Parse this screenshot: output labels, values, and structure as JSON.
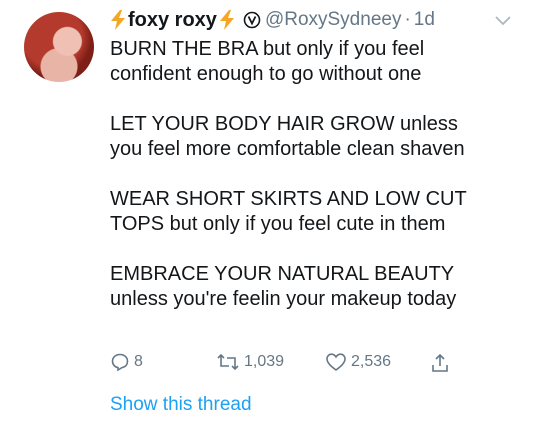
{
  "tweet": {
    "display_name": "foxy roxy",
    "handle": "@RoxySydneey",
    "separator": "·",
    "timestamp": "1d",
    "paragraphs": [
      {
        "line1": "BURN THE BRA but only if you feel",
        "line2": "confident enough to go without one"
      },
      {
        "line1": "LET YOUR BODY HAIR GROW unless",
        "line2": "you feel more comfortable clean shaven"
      },
      {
        "line1": "WEAR SHORT SKIRTS AND LOW CUT",
        "line2": "TOPS but only if you feel cute in them"
      },
      {
        "line1": "EMBRACE YOUR NATURAL BEAUTY",
        "line2": "unless you're feelin your makeup today"
      }
    ],
    "actions": {
      "reply_count": "8",
      "retweet_count": "1,039",
      "like_count": "2,536"
    },
    "show_thread": "Show this thread"
  },
  "colors": {
    "text": "#14171a",
    "secondary": "#657786",
    "link": "#1da1f2",
    "bolt": "#f5a623"
  },
  "icons": [
    "lightning-bolt-icon",
    "verified-icon",
    "chevron-down-icon",
    "reply-icon",
    "retweet-icon",
    "like-icon",
    "share-icon"
  ]
}
